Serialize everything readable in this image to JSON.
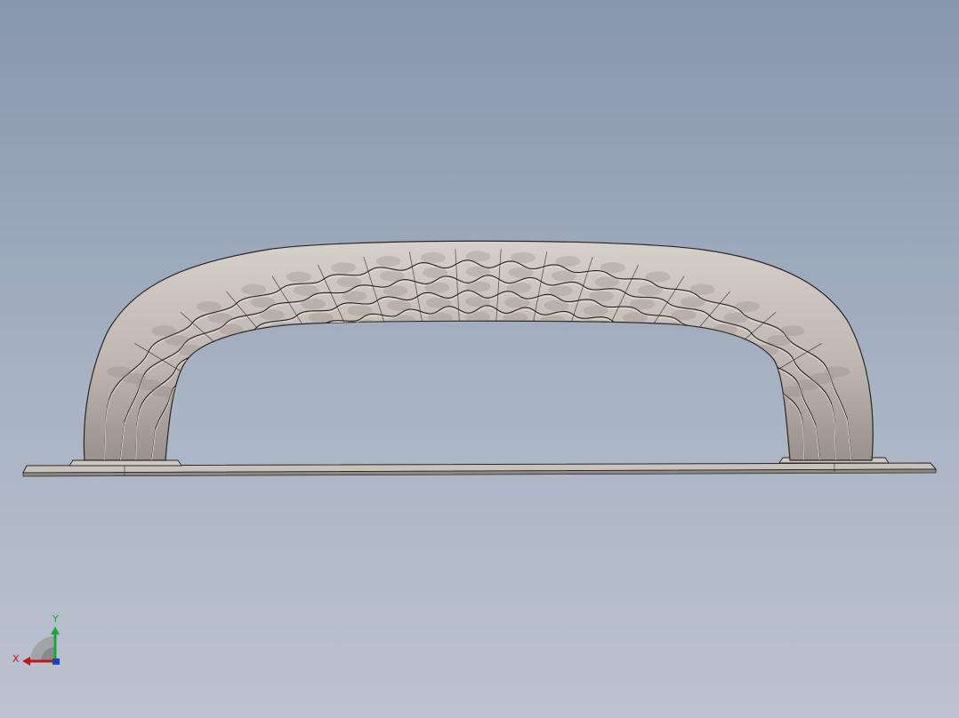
{
  "viewport": {
    "background_top": "#8797ad",
    "background_bottom": "#bcc3d0"
  },
  "model": {
    "name_icon": "textured-arch-handle",
    "surface_color": "#c9c2bb",
    "shade_color": "#a59d96",
    "edge_color": "#2a2624",
    "base_plate_color": "#c3bcb5"
  },
  "triad": {
    "x_label": "X",
    "y_label": "Y",
    "x_color": "#c0161b",
    "y_color": "#18a83a",
    "z_color": "#1b3fd0"
  }
}
